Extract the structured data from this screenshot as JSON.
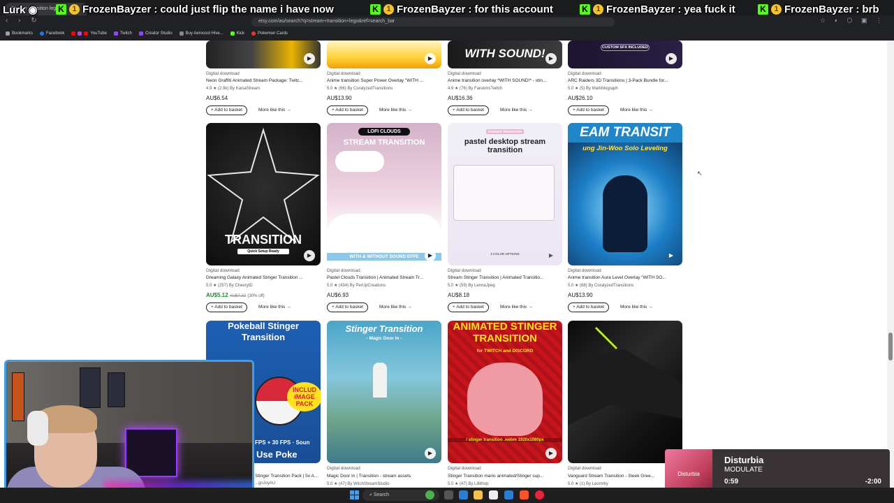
{
  "browser": {
    "tab_title": "Stream transition lego",
    "url": "etsy.com/au/search?q=stream+transition+lego&ref=search_bar",
    "bookmarks": [
      "Bookmarks",
      "Facebook",
      "YouTube",
      "Twitch",
      "Creator Studio",
      "Buy Aerocool Hive...",
      "Kick",
      "Pokemon Cards"
    ]
  },
  "ticker": {
    "items": [
      {
        "user": "Lurk",
        "text": ""
      },
      {
        "user": "FrozenBayzer",
        "text": "could just flip the name i have now"
      },
      {
        "user": "FrozenBayzer",
        "text": "for this account"
      },
      {
        "user": "FrozenBayzer",
        "text": "yea fuck it"
      },
      {
        "user": "FrozenBayzer",
        "text": "brb"
      }
    ]
  },
  "listings": [
    {
      "download": "Digital download",
      "title": "Neon Graffiti Animated Stream Package: Twitc...",
      "rating": "4.9 ★ (2.9k) By KaisaStream",
      "price": "AU$6.54",
      "add": "+ Add to basket",
      "more": "More like this →"
    },
    {
      "download": "Digital download",
      "title": "Anime transition Super Power Overlay \"WITH ...",
      "rating": "5.0 ★ (66) By CoralyzedTransitions",
      "price": "AU$13.90",
      "add": "+ Add to basket",
      "more": "More like this →"
    },
    {
      "download": "Digital download",
      "title": "Anime transition overlay *WITH SOUND!* - stin...",
      "rating": "4.9 ★ (76) By FarukmsTwitch",
      "price": "AU$16.36",
      "add": "+ Add to basket",
      "more": "More like this →",
      "thumb_text": "WITH SOUND!"
    },
    {
      "download": "Digital download",
      "title": "ARC Raiders 3D Transitions | 3-Pack Bundle for...",
      "rating": "5.0 ★ (5) By MarkMograph",
      "price": "AU$26.10",
      "add": "+ Add to basket",
      "more": "More like this →",
      "thumb_text": "CUSTOM SFX INCLUDED"
    },
    {
      "download": "Digital download",
      "title": "Dreaming Galaxy Animated Stinger Transition ...",
      "rating": "5.0 ★ (257) By CheeryID",
      "price": "AU$5.12",
      "orig_price": "AU$7.32",
      "discount": "(30% off)",
      "add": "+ Add to basket",
      "more": "More like this →",
      "thumb_text": "TRANSITION",
      "thumb_sub": "Quick Setup Ready"
    },
    {
      "download": "Digital download",
      "title": "Pastel Clouds Transition | Animated Stream Tr...",
      "rating": "5.0 ★ (434) By PerUpCreations",
      "price": "AU$6.93",
      "add": "+ Add to basket",
      "more": "More like this →",
      "thumb_text": "STREAM TRANSITION",
      "thumb_badge": "LOFI CLOUDS",
      "thumb_sub": "WITH & WITHOUT SOUND EFFE"
    },
    {
      "download": "Digital download",
      "title": "Stream Stinger Transition | Animated Transitio...",
      "rating": "5.0 ★ (59) By LennaJpeg",
      "price": "AU$8.18",
      "add": "+ Add to basket",
      "more": "More like this →",
      "thumb_text": "pastel desktop stream transition",
      "thumb_badge": "STINGER TRANSITION",
      "thumb_sub": "3 COLOR OPTIONS"
    },
    {
      "download": "Digital download",
      "title": "Anime transition Aura Level Overlay \"WITH SO...",
      "rating": "5.0 ★ (68) By CoralyzedTransitions",
      "price": "AU$13.90",
      "add": "+ Add to basket",
      "more": "More like this →",
      "thumb_text": "EAM TRANSIT",
      "thumb_sub": "ung Jin-Woo Solo Leveling"
    },
    {
      "download": "Digital download",
      "title": "Stinger Transition Pack | 5x Animate...",
      "rating": "...gnJoyAU",
      "thumb_text": "Pokeball Stinger Transition",
      "thumb_badge": "INCLUD iMAGE PACK",
      "thumb_sub": "FPS + 30 FPS · Soun",
      "thumb_sub2": "Use Poke"
    },
    {
      "download": "Digital download",
      "title": "Magic Door In | Transition - stream assets",
      "rating": "5.0 ★ (47) By WitchStreamStudio",
      "thumb_text": "Stinger Transition",
      "thumb_sub": "- Magic Door In -"
    },
    {
      "download": "Digital download",
      "title": "Stinger Transition mario animated/Stinger sup...",
      "rating": "5.0 ★ (47) By Lillithop",
      "thumb_text": "ANIMATED STINGER TRANSITION",
      "thumb_badge": "for TWITCH and DISCORD",
      "thumb_sub": "/ stinger transition .webm 1920x1080px"
    },
    {
      "download": "Digital download",
      "title": "Vanguard Stream Transition - Sleek Gree...",
      "rating": "5.0 ★ (1) By Leomrky"
    }
  ],
  "music": {
    "song": "Disturbia",
    "artist": "MODULATE",
    "art_text": "Disturbia",
    "elapsed": "0:59",
    "remaining": "-2:00",
    "progress": 0.33
  },
  "taskbar": {
    "search": "Search"
  }
}
